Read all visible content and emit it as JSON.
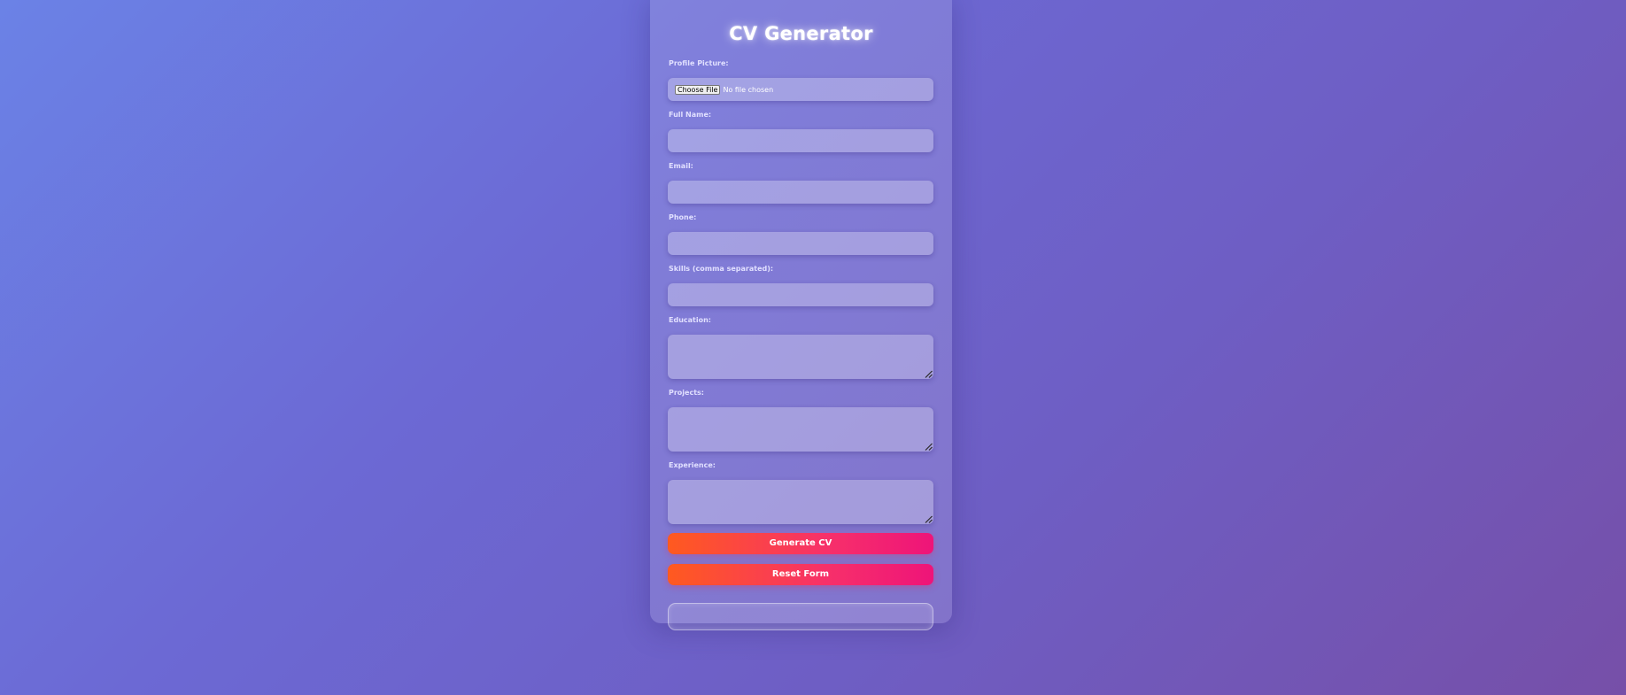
{
  "form": {
    "title": "CV Generator",
    "profile_picture": {
      "label": "Profile Picture:",
      "button_label": "Choose File",
      "status": "No file chosen"
    },
    "full_name": {
      "label": "Full Name:",
      "value": "",
      "placeholder": ""
    },
    "email": {
      "label": "Email:",
      "value": "",
      "placeholder": ""
    },
    "phone": {
      "label": "Phone:",
      "value": "",
      "placeholder": ""
    },
    "skills": {
      "label": "Skills (comma separated):",
      "value": "",
      "placeholder": ""
    },
    "education": {
      "label": "Education:",
      "value": ""
    },
    "projects": {
      "label": "Projects:",
      "value": ""
    },
    "experience": {
      "label": "Experience:",
      "value": ""
    },
    "generate_label": "Generate CV",
    "reset_label": "Reset Form",
    "output_text": ""
  },
  "colors": {
    "background_start": "#6b82e6",
    "background_end": "#764fa8",
    "button_start": "#ff5a1f",
    "button_end": "#ee1479"
  },
  "icons": {
    "textarea_resize": "resize-grip-icon"
  }
}
